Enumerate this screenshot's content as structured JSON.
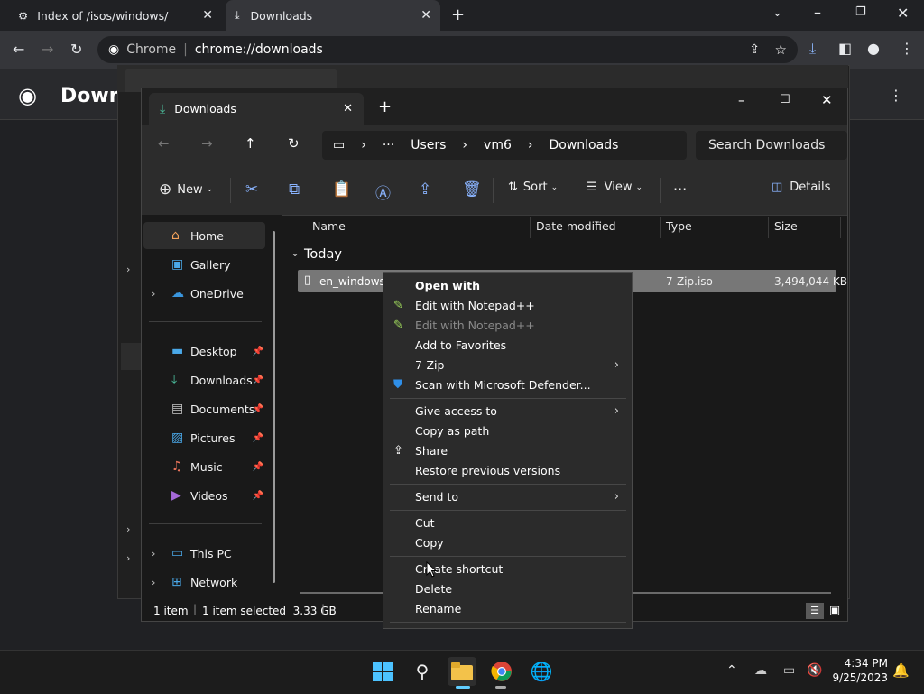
{
  "chrome": {
    "tabs": [
      {
        "title": "Index of /isos/windows/"
      },
      {
        "title": "Downloads"
      }
    ],
    "omnibox_site": "Chrome",
    "omnibox_url": "chrome://downloads",
    "page_title_fragment": "Downl"
  },
  "explorer": {
    "tab_title": "Downloads",
    "breadcrumb": [
      "Users",
      "vm6",
      "Downloads"
    ],
    "search_placeholder": "Search Downloads",
    "commands": {
      "new": "New",
      "sort": "Sort",
      "view": "View",
      "details": "Details"
    },
    "nav": [
      {
        "label": "Home",
        "icon": "home-icon"
      },
      {
        "label": "Gallery",
        "icon": "gallery-icon"
      },
      {
        "label": "OneDrive",
        "icon": "cloud-icon"
      },
      {
        "label": "Desktop",
        "icon": "desktop-icon"
      },
      {
        "label": "Downloads",
        "icon": "download-icon"
      },
      {
        "label": "Documents",
        "icon": "document-icon"
      },
      {
        "label": "Pictures",
        "icon": "picture-icon"
      },
      {
        "label": "Music",
        "icon": "music-icon"
      },
      {
        "label": "Videos",
        "icon": "video-icon"
      },
      {
        "label": "This PC",
        "icon": "pc-icon"
      },
      {
        "label": "Network",
        "icon": "network-icon"
      }
    ],
    "columns": {
      "name": "Name",
      "date": "Date modified",
      "type": "Type",
      "size": "Size"
    },
    "group_label": "Today",
    "file": {
      "name": "en_windows_",
      "type": "7-Zip.iso",
      "size": "3,494,044 KB"
    },
    "status": {
      "items": "1 item",
      "selected": "1 item selected  3.33 GB"
    }
  },
  "context_menu": {
    "open_with": "Open with",
    "edit_npp": "Edit with Notepad++",
    "edit_npp_disabled": "Edit with Notepad++",
    "add_fav": "Add to Favorites",
    "seven_zip": "7-Zip",
    "scan": "Scan with Microsoft Defender...",
    "give_access": "Give access to",
    "copy_path": "Copy as path",
    "share": "Share",
    "restore": "Restore previous versions",
    "send_to": "Send to",
    "cut": "Cut",
    "copy": "Copy",
    "create_shortcut": "Create shortcut",
    "delete": "Delete",
    "rename": "Rename"
  },
  "taskbar": {
    "time": "4:34 PM",
    "date": "9/25/2023"
  },
  "colors": {
    "accent": "#0078d4",
    "folder": "#f3c24a"
  }
}
